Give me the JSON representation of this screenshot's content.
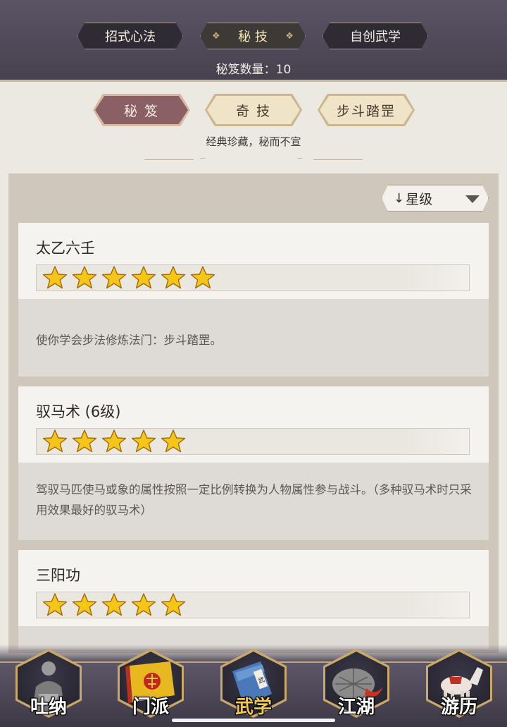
{
  "header": {
    "tabs": [
      {
        "label": "招式心法",
        "active": false
      },
      {
        "label": "秘 技",
        "active": true
      },
      {
        "label": "自创武学",
        "active": false
      }
    ],
    "count_label": "秘笈数量：10"
  },
  "sub_tabs": [
    {
      "label": "秘 笈",
      "active": true
    },
    {
      "label": "奇 技",
      "active": false
    },
    {
      "label": "步斗踏罡",
      "active": false
    }
  ],
  "subtitle": "经典珍藏，秘而不宣",
  "sort": {
    "arrow": "↓",
    "label": "星级",
    "icon": "dropdown-triangle"
  },
  "cards": [
    {
      "title": "太乙六壬",
      "stars": 6,
      "description": "使你学会步法修炼法门：步斗踏罡。"
    },
    {
      "title": "驭马术 (6级)",
      "stars": 5,
      "description": "驾驭马匹使马或象的属性按照一定比例转换为人物属性参与战斗。（多种驭马术时只采用效果最好的驭马术）"
    },
    {
      "title": "三阳功",
      "stars": 5,
      "description": ""
    }
  ],
  "bottom_nav": [
    {
      "label": "吐纳",
      "icon": "meditating-monk-icon",
      "active": false
    },
    {
      "label": "门派",
      "icon": "sect-banner-icon",
      "active": false
    },
    {
      "label": "武学",
      "icon": "martial-book-icon",
      "active": true
    },
    {
      "label": "江湖",
      "icon": "bamboo-hat-icon",
      "active": false
    },
    {
      "label": "游历",
      "icon": "white-horse-icon",
      "active": false
    }
  ],
  "colors": {
    "header_bg": "#4e4858",
    "active_subtab": "#8a6066",
    "star": "#f5c518",
    "active_nav_label": "#f2c94c"
  }
}
